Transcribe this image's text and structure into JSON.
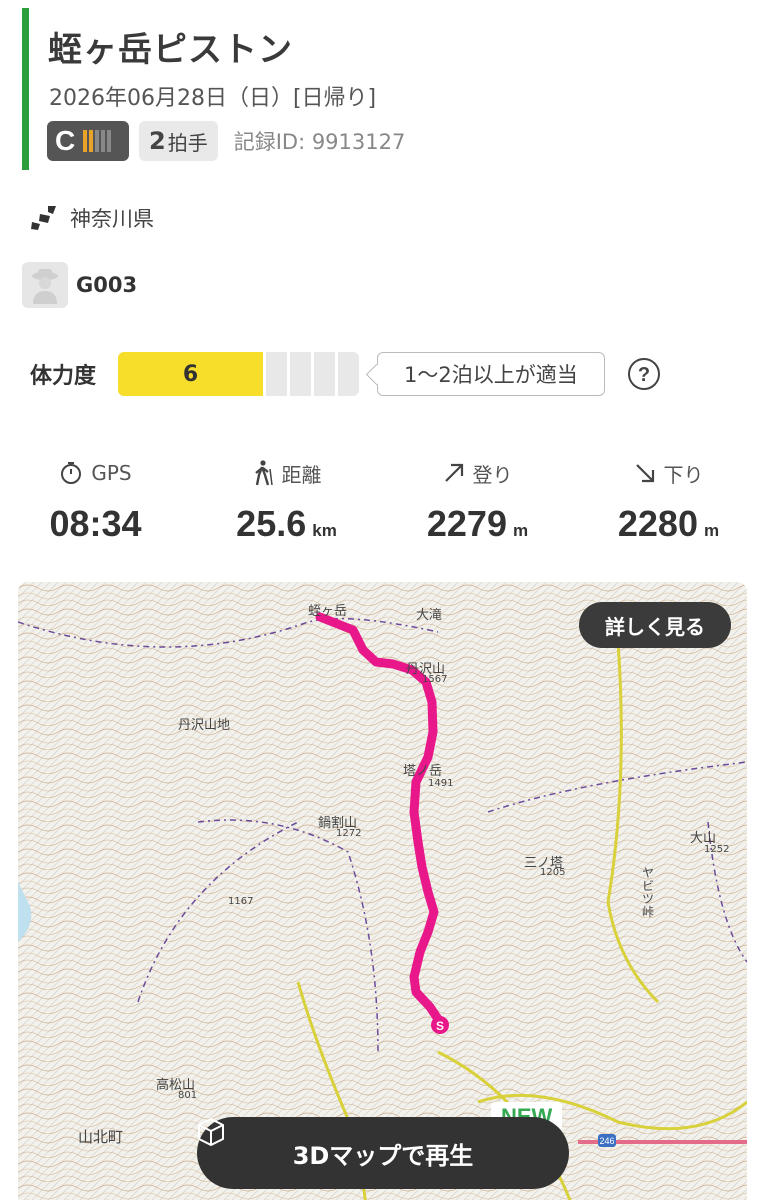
{
  "header": {
    "title": "蛭ヶ岳ピストン",
    "date": "2026年06月28日（日）[日帰り]",
    "grade_letter": "C",
    "grade_level_bars": 2,
    "day_badge_num": "2",
    "day_badge_suffix": "拍手",
    "record_id": "記録ID: 9913127"
  },
  "location": {
    "prefecture": "神奈川県",
    "icon": "map-pin-icon"
  },
  "user": {
    "name": "G003",
    "avatar_icon": "hiker-avatar-icon"
  },
  "stamina": {
    "label": "体力度",
    "value": "6",
    "level_fraction": 0.6,
    "note": "1〜2泊以上が適当",
    "help_icon": "question-icon"
  },
  "stats": [
    {
      "icon": "stopwatch-icon",
      "label": "GPS",
      "value": "08:34",
      "unit": ""
    },
    {
      "icon": "walker-icon",
      "label": "距離",
      "value": "25.6",
      "unit": "km"
    },
    {
      "icon": "arrow-up-right-icon",
      "label": "登り",
      "value": "2279",
      "unit": "m"
    },
    {
      "icon": "arrow-down-right-icon",
      "label": "下り",
      "value": "2280",
      "unit": "m"
    }
  ],
  "map": {
    "detail_button": "詳しく見る",
    "play_button": "3Dマップで再生",
    "new_tag": "NEW",
    "route_color": "#e8188a",
    "labels": {
      "hiru": "蛭ヶ岳",
      "ohora": "大滝",
      "kazawa": "丹沢山",
      "tanzawa": "丹沢山地",
      "tou": "塔ノ岳",
      "nabewari": "鍋割山",
      "sannotou": "三ノ塔",
      "oyama": "大山",
      "yabitsu": "ヤビツ峠",
      "tanzawayama_elev": "1567",
      "tou_elev": "1491",
      "nabe_elev": "1272",
      "san_elev": "1205",
      "hinoki_elev": "1167",
      "oyama_elev": "1252",
      "takamatsu": "高松山",
      "takamatsu_elev": "801",
      "yamakita": "山北町",
      "start": "S",
      "route_no": "246"
    }
  }
}
